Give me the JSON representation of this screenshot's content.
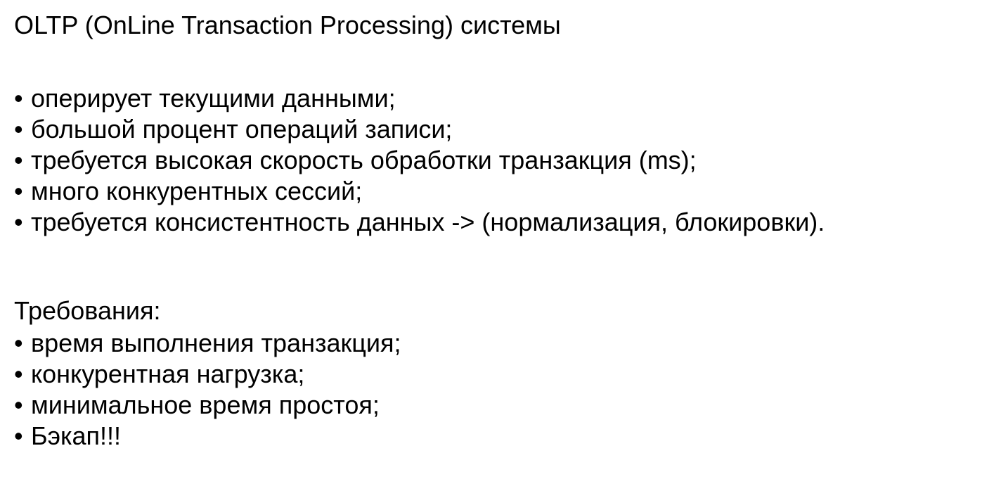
{
  "title": "OLTP (OnLine Transaction Processing) системы",
  "bullet_glyph": "•",
  "characteristics": [
    "оперирует текущими данными;",
    "большой процент операций записи;",
    "требуется высокая скорость обработки транзакция (ms);",
    "много конкурентных сессий;",
    "требуется консистентность данных -> (нормализация, блокировки)."
  ],
  "requirements_heading": "Требования:",
  "requirements": [
    "время выполнения транзакция;",
    "конкурентная нагрузка;",
    "минимальное время простоя;",
    "Бэкап!!!"
  ]
}
